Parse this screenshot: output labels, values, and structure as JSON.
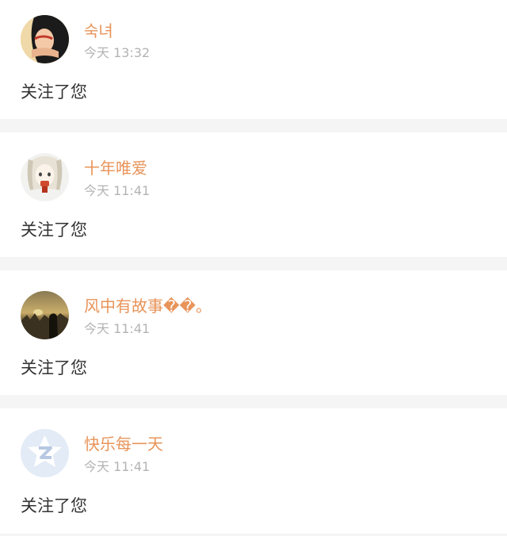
{
  "notifications": [
    {
      "username": "숙녀",
      "time": "今天 13:32",
      "message": "关注了您",
      "avatar_icon": "girl-photo-avatar"
    },
    {
      "username": "十年唯爱",
      "time": "今天 11:41",
      "message": "关注了您",
      "avatar_icon": "anime-girl-avatar"
    },
    {
      "username": "风中有故事��。",
      "time": "今天 11:41",
      "message": "关注了您",
      "avatar_icon": "sunset-field-avatar"
    },
    {
      "username": "快乐每一天",
      "time": "今天 11:41",
      "message": "关注了您",
      "avatar_icon": "default-qq-avatar"
    }
  ],
  "colors": {
    "username": "#e8945a",
    "timestamp": "#b3b3b3",
    "message": "#333333",
    "separator": "#f5f5f5"
  }
}
